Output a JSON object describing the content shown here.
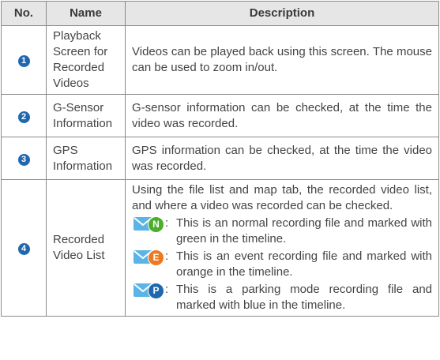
{
  "headers": {
    "no": "No.",
    "name": "Name",
    "description": "Description"
  },
  "rows": [
    {
      "num": "1",
      "name": "Playback Screen for Recorded Videos",
      "description": "Videos can be played back using this screen. The mouse can be used to zoom in/out."
    },
    {
      "num": "2",
      "name": "G-Sensor Information",
      "description": "G-sensor information can be checked, at the time the video was recorded."
    },
    {
      "num": "3",
      "name": "GPS Information",
      "description": "GPS information can be checked, at the time the video was recorded."
    },
    {
      "num": "4",
      "name": "Recorded Video List",
      "description": "Using the file list and map tab, the recorded video list, and where a video was recorded can be checked.",
      "legend": [
        {
          "letter": "N",
          "color": "#4caf2b",
          "icon": "normal-recording-icon",
          "text": "This is an normal recording file and marked with green in the timeline."
        },
        {
          "letter": "E",
          "color": "#f0781e",
          "icon": "event-recording-icon",
          "text": "This is an event recording file and marked with orange in the timeline."
        },
        {
          "letter": "P",
          "color": "#1f68b0",
          "icon": "parking-recording-icon",
          "text": "This is a parking mode recording file and marked with blue in the timeline."
        }
      ]
    }
  ],
  "colon": ":",
  "colors": {
    "badge": "#1f68b0",
    "header_bg": "#e6e6e6",
    "border": "#8a8a8a",
    "envelope": "#5ab4e6"
  }
}
